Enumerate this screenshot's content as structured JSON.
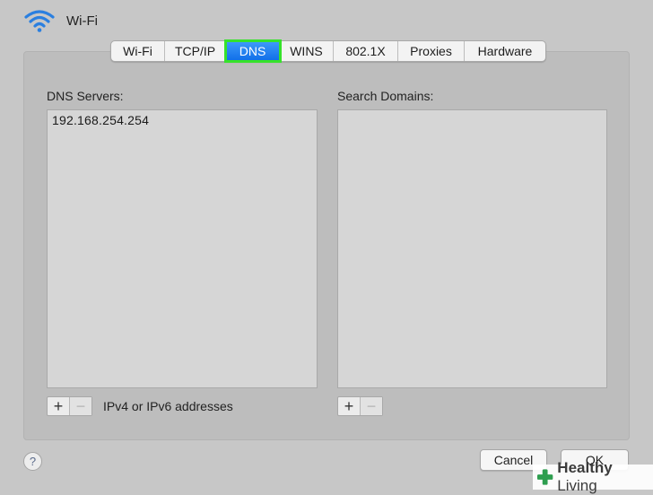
{
  "window": {
    "title": "Wi-Fi",
    "icon": "wifi-icon"
  },
  "tabs": [
    {
      "label": "Wi-Fi",
      "selected": false
    },
    {
      "label": "TCP/IP",
      "selected": false
    },
    {
      "label": "DNS",
      "selected": true
    },
    {
      "label": "WINS",
      "selected": false
    },
    {
      "label": "802.1X",
      "selected": false
    },
    {
      "label": "Proxies",
      "selected": false
    },
    {
      "label": "Hardware",
      "selected": false
    }
  ],
  "dns_servers": {
    "label": "DNS Servers:",
    "items": [
      "192.168.254.254"
    ],
    "add_label": "+",
    "remove_label": "−",
    "hint": "IPv4 or IPv6 addresses"
  },
  "search_domains": {
    "label": "Search Domains:",
    "items": [],
    "add_label": "+",
    "remove_label": "−"
  },
  "footer": {
    "help_label": "?",
    "cancel_label": "Cancel",
    "ok_label": "OK"
  },
  "watermark": {
    "brand": "Healthy",
    "brand_suffix": "Living",
    "icon": "cross-icon"
  },
  "colors": {
    "selected_tab": "#1877f2",
    "highlight_outline": "#36e22a",
    "window_bg": "#c7c7c7"
  }
}
